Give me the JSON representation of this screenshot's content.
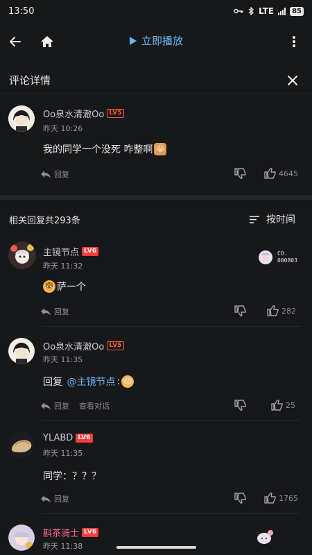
{
  "status_bar": {
    "time": "13:50",
    "network": "LTE",
    "battery": "85"
  },
  "topbar": {
    "play_label": "立即播放"
  },
  "detail_header": {
    "title": "评论详情"
  },
  "main_comment": {
    "user": "Oo泉水清澈Oo",
    "level": "LV5",
    "time": "昨天 10:26",
    "text": "我的同学一个没死 咋整啊",
    "reply_label": "回复",
    "likes": "4645"
  },
  "replies_header": {
    "count_label": "相关回复共293条",
    "sort_label": "按时间"
  },
  "replies": [
    {
      "user": "主镜节点",
      "level": "LV6",
      "time": "昨天 11:32",
      "text": "萨一个",
      "reply_label": "回复",
      "likes": "282",
      "badge_line1": "CO.",
      "badge_line2": "000803"
    },
    {
      "user": "Oo泉水清澈Oo",
      "level": "LV5",
      "time": "昨天 11:35",
      "text_prefix": "回复 ",
      "mention": "@主镜节点",
      "text_suffix": ":",
      "reply_label": "回复",
      "view_conv": "查看对话",
      "likes": "25"
    },
    {
      "user": "YLABD",
      "level": "LV6",
      "time": "昨天 11:35",
      "text": "同学：？？？",
      "reply_label": "回复",
      "likes": "1765"
    },
    {
      "user": "斟茶骑士",
      "level": "LV6",
      "time": "昨天 11:38"
    }
  ],
  "colors": {
    "background": "#17181a",
    "accent_blue": "#6ab6f2",
    "level_orange": "#ff5a2c",
    "name_pink": "#ff6699"
  }
}
